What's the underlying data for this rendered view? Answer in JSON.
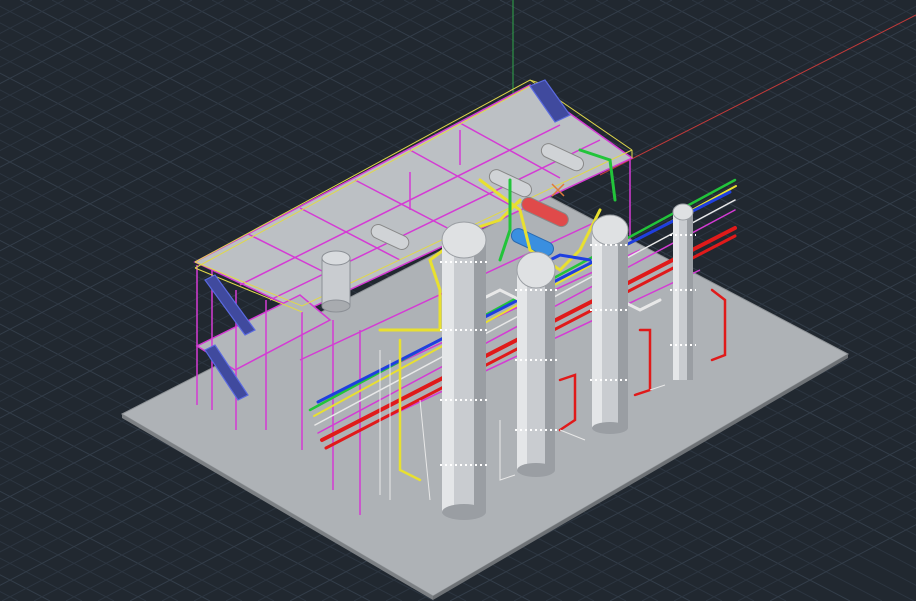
{
  "viewport": {
    "background": "#212830",
    "grid_color": "#2c3540",
    "grid_major_color": "#333d49"
  },
  "model": {
    "description_colors": {
      "floor": "#aeb2b6",
      "deck": "#bcc0c4",
      "steel": "#d43bd4",
      "railing": "#e0d84a",
      "vessel": "#c9ccd0",
      "vessel_shade": "#8c9096",
      "pipe_yellow": "#e8e030",
      "pipe_green": "#22c43a",
      "pipe_blue": "#1f3fe0",
      "pipe_red": "#e01a1a",
      "pipe_white": "#e8e8e8",
      "pipe_lightblue": "#3a8fe0"
    },
    "columns": [
      "column-1",
      "column-2",
      "column-3",
      "column-4"
    ],
    "ucs_axis_colors": {
      "y_axis": "#2fa84a",
      "x_axis": "#c23a3a"
    }
  }
}
